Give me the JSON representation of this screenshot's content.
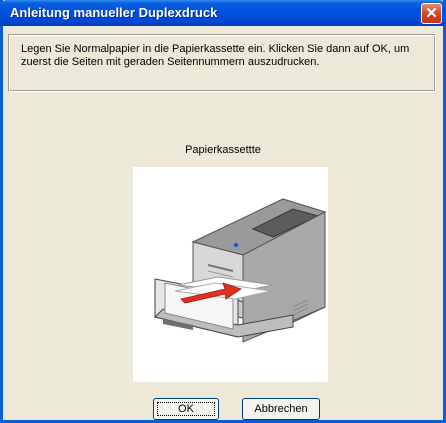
{
  "window": {
    "title": "Anleitung manueller Duplexdruck",
    "close_label": "✕"
  },
  "message": "Legen Sie Normalpapier in die Papierkassette ein. Klicken Sie dann auf OK, um zuerst die Seiten mit geraden Seitennummern auszudrucken.",
  "image": {
    "caption": "Papierkassettte",
    "icon": "printer-paper-tray-illustration"
  },
  "buttons": {
    "ok_label": "OK",
    "cancel_label": "Abbrechen"
  }
}
